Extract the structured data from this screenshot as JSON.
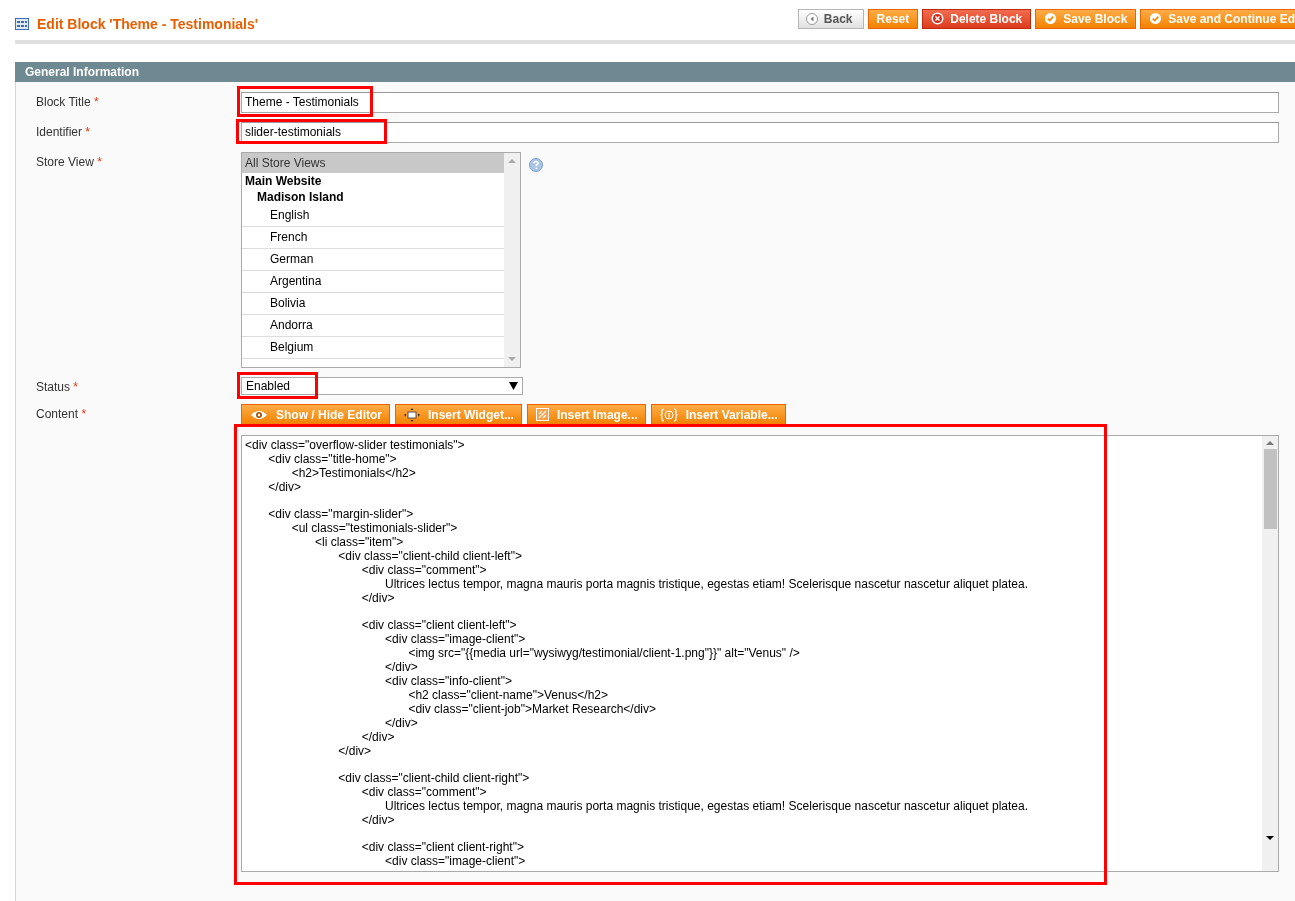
{
  "header": {
    "title": "Edit Block 'Theme - Testimonials'",
    "buttons": [
      {
        "label": "Back",
        "kind": "back"
      },
      {
        "label": "Reset",
        "kind": "plain"
      },
      {
        "label": "Delete Block",
        "kind": "delete"
      },
      {
        "label": "Save Block",
        "kind": "save"
      },
      {
        "label": "Save and Continue Ed",
        "kind": "save"
      }
    ]
  },
  "section": {
    "title": "General Information"
  },
  "fields": [
    {
      "label": "Block Title",
      "required": "*",
      "value": "Theme - Testimonials",
      "highlighted": true
    },
    {
      "label": "Identifier",
      "required": "*",
      "value": "slider-testimonials",
      "highlighted": true
    }
  ],
  "store_view": {
    "label": "Store View",
    "required": "*",
    "items": [
      {
        "label": "All Store Views",
        "kind": "option",
        "selected": true
      },
      {
        "label": "Main Website",
        "kind": "group",
        "children": [
          {
            "label": "Madison Island",
            "kind": "group",
            "children": [
              {
                "label": "English",
                "kind": "option",
                "selected": false
              },
              {
                "label": "French",
                "kind": "option",
                "selected": false
              },
              {
                "label": "German",
                "kind": "option",
                "selected": false
              },
              {
                "label": "Argentina",
                "kind": "option",
                "selected": false
              },
              {
                "label": "Bolivia",
                "kind": "option",
                "selected": false
              },
              {
                "label": "Andorra",
                "kind": "option",
                "selected": false
              },
              {
                "label": "Belgium",
                "kind": "option",
                "selected": false
              }
            ]
          }
        ]
      }
    ]
  },
  "status": {
    "label": "Status",
    "required": "*",
    "value": "Enabled",
    "highlighted": true
  },
  "content": {
    "label": "Content",
    "required": "*",
    "highlighted": true,
    "buttons": [
      {
        "label": "Show / Hide Editor",
        "kind": "eye"
      },
      {
        "label": "Insert Widget...",
        "kind": "widget"
      },
      {
        "label": "Insert Image...",
        "kind": "image"
      },
      {
        "label": "Insert Variable...",
        "kind": "variable"
      }
    ],
    "lines": [
      {
        "text": "<div class=\"overflow-slider testimonials\">",
        "gap_before": false
      },
      {
        "text": "\t<div class=\"title-home\">",
        "gap_before": false
      },
      {
        "text": "\t\t<h2>Testimonials</h2>",
        "gap_before": false
      },
      {
        "text": "\t</div>",
        "gap_before": false
      },
      {
        "text": "\t<div class=\"margin-slider\">",
        "gap_before": true
      },
      {
        "text": "\t\t<ul class=\"testimonials-slider\">",
        "gap_before": false
      },
      {
        "text": "\t\t\t<li class=\"item\">",
        "gap_before": false
      },
      {
        "text": "\t\t\t\t<div class=\"client-child client-left\">",
        "gap_before": false
      },
      {
        "text": "\t\t\t\t\t<div class=\"comment\">",
        "gap_before": false
      },
      {
        "text": "\t\t\t\t\t\tUltrices lectus tempor, magna mauris porta magnis tristique, egestas etiam! Scelerisque nascetur nascetur aliquet platea.",
        "gap_before": false
      },
      {
        "text": "\t\t\t\t\t</div>",
        "gap_before": false
      },
      {
        "text": "\t\t\t\t\t<div class=\"client client-left\">",
        "gap_before": true
      },
      {
        "text": "\t\t\t\t\t\t<div class=\"image-client\">",
        "gap_before": false
      },
      {
        "text": "\t\t\t\t\t\t\t<img src=\"{{media url=\"wysiwyg/testimonial/client-1.png\"}}\" alt=\"Venus\" />",
        "gap_before": false
      },
      {
        "text": "\t\t\t\t\t\t</div>",
        "gap_before": false
      },
      {
        "text": "\t\t\t\t\t\t<div class=\"info-client\">",
        "gap_before": false
      },
      {
        "text": "\t\t\t\t\t\t\t<h2 class=\"client-name\">Venus</h2>",
        "gap_before": false
      },
      {
        "text": "\t\t\t\t\t\t\t<div class=\"client-job\">Market Research</div>",
        "gap_before": false
      },
      {
        "text": "\t\t\t\t\t\t</div>",
        "gap_before": false
      },
      {
        "text": "\t\t\t\t\t</div>",
        "gap_before": false
      },
      {
        "text": "\t\t\t\t</div>",
        "gap_before": false
      },
      {
        "text": "\t\t\t\t<div class=\"client-child client-right\">",
        "gap_before": true
      },
      {
        "text": "\t\t\t\t\t<div class=\"comment\">",
        "gap_before": false
      },
      {
        "text": "\t\t\t\t\t\tUltrices lectus tempor, magna mauris porta magnis tristique, egestas etiam! Scelerisque nascetur nascetur aliquet platea.",
        "gap_before": false
      },
      {
        "text": "\t\t\t\t\t</div>",
        "gap_before": false
      },
      {
        "text": "\t\t\t\t\t<div class=\"client client-right\">",
        "gap_before": true
      },
      {
        "text": "\t\t\t\t\t\t<div class=\"image-client\">",
        "gap_before": false
      }
    ]
  }
}
